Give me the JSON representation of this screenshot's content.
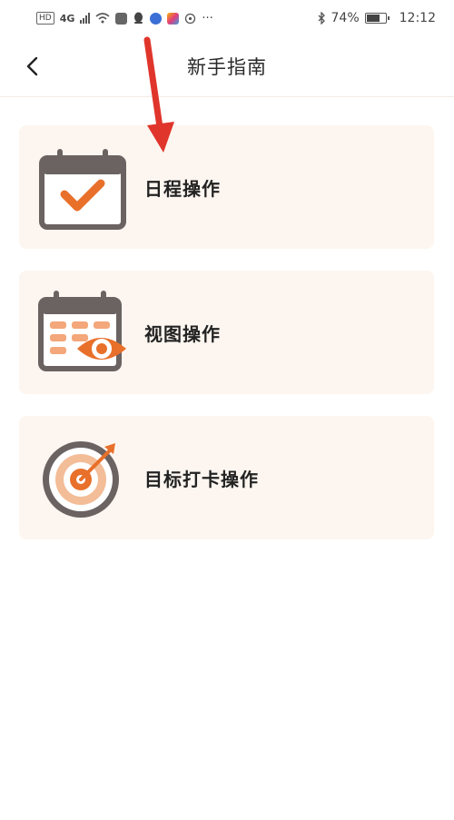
{
  "status_bar": {
    "hd": "HD",
    "network": "4G",
    "battery_percent": "74%",
    "battery_level": 0.74,
    "time": "12:12"
  },
  "header": {
    "title": "新手指南"
  },
  "guide_items": [
    {
      "label": "日程操作",
      "icon": "calendar-check-icon"
    },
    {
      "label": "视图操作",
      "icon": "calendar-view-icon"
    },
    {
      "label": "目标打卡操作",
      "icon": "target-icon"
    }
  ],
  "colors": {
    "accent": "#e8702a",
    "card_bg": "#fdf6f0",
    "icon_gray": "#6b6362",
    "annotation_arrow": "#e0352b"
  }
}
